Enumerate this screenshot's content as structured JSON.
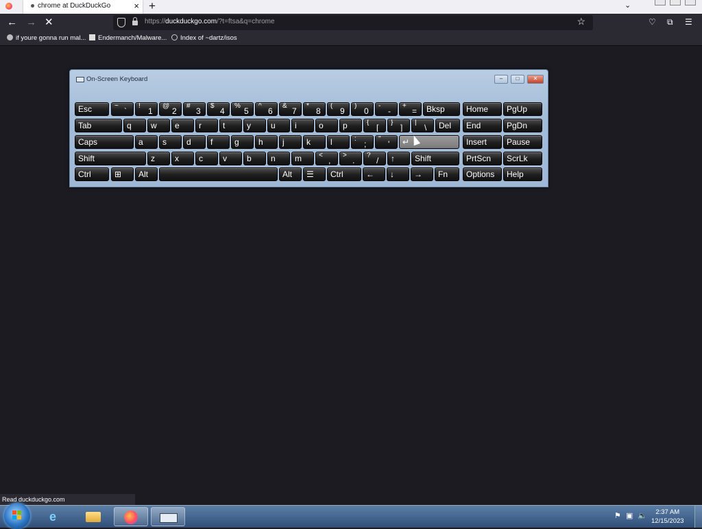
{
  "browser": {
    "active_tab_title": "chrome at DuckDuckGo",
    "url_host": "duckduckgo.com",
    "url_prefix": "https://",
    "url_suffix": "/?t=ftsa&q=chrome",
    "bookmarks": [
      "if youre gonna run mal...",
      "Endermanch/Malware...",
      "Index of ~dartz/isos"
    ],
    "status_text": "Read duckduckgo.com"
  },
  "osk": {
    "title": "On-Screen Keyboard",
    "rows": [
      [
        {
          "label": "Esc"
        },
        {
          "shift": "~",
          "main": "`"
        },
        {
          "shift": "!",
          "main": "1"
        },
        {
          "shift": "@",
          "main": "2"
        },
        {
          "shift": "#",
          "main": "3"
        },
        {
          "shift": "$",
          "main": "4"
        },
        {
          "shift": "%",
          "main": "5"
        },
        {
          "shift": "^",
          "main": "6"
        },
        {
          "shift": "&",
          "main": "7"
        },
        {
          "shift": "*",
          "main": "8"
        },
        {
          "shift": "(",
          "main": "9"
        },
        {
          "shift": ")",
          "main": "0"
        },
        {
          "shift": "-",
          "main": "-"
        },
        {
          "shift": "+",
          "main": "="
        },
        {
          "label": "Bksp"
        },
        {
          "label": "Home"
        },
        {
          "label": "PgUp"
        }
      ],
      [
        {
          "label": "Tab"
        },
        {
          "label": "q"
        },
        {
          "label": "w"
        },
        {
          "label": "e"
        },
        {
          "label": "r"
        },
        {
          "label": "t"
        },
        {
          "label": "y"
        },
        {
          "label": "u"
        },
        {
          "label": "i"
        },
        {
          "label": "o"
        },
        {
          "label": "p"
        },
        {
          "shift": "{",
          "main": "["
        },
        {
          "shift": "}",
          "main": "]"
        },
        {
          "shift": "|",
          "main": "\\"
        },
        {
          "label": "Del"
        },
        {
          "label": "End"
        },
        {
          "label": "PgDn"
        }
      ],
      [
        {
          "label": "Caps"
        },
        {
          "label": "a"
        },
        {
          "label": "s"
        },
        {
          "label": "d"
        },
        {
          "label": "f"
        },
        {
          "label": "g"
        },
        {
          "label": "h"
        },
        {
          "label": "j"
        },
        {
          "label": "k"
        },
        {
          "label": "l"
        },
        {
          "shift": ":",
          "main": ";"
        },
        {
          "shift": "\"",
          "main": "'"
        },
        {
          "label": "↵"
        },
        {
          "label": "Insert"
        },
        {
          "label": "Pause"
        }
      ],
      [
        {
          "label": "Shift"
        },
        {
          "label": "z"
        },
        {
          "label": "x"
        },
        {
          "label": "c"
        },
        {
          "label": "v"
        },
        {
          "label": "b"
        },
        {
          "label": "n"
        },
        {
          "label": "m"
        },
        {
          "shift": "<",
          "main": ","
        },
        {
          "shift": ">",
          "main": "."
        },
        {
          "shift": "?",
          "main": "/"
        },
        {
          "label": "↑"
        },
        {
          "label": "Shift"
        },
        {
          "label": "PrtScn"
        },
        {
          "label": "ScrLk"
        }
      ],
      [
        {
          "label": "Ctrl"
        },
        {
          "label": "⊞"
        },
        {
          "label": "Alt"
        },
        {
          "label": ""
        },
        {
          "label": "Alt"
        },
        {
          "label": "☰"
        },
        {
          "label": "Ctrl"
        },
        {
          "label": "←"
        },
        {
          "label": "↓"
        },
        {
          "label": "→"
        },
        {
          "label": "Fn"
        },
        {
          "label": "Options"
        },
        {
          "label": "Help"
        }
      ]
    ],
    "highlighted_key": "↵"
  },
  "taskbar": {
    "time": "2:37 AM",
    "date": "12/15/2023",
    "items": [
      "internet-explorer",
      "file-explorer",
      "firefox",
      "on-screen-keyboard"
    ],
    "active_item": "firefox"
  },
  "colors": {
    "page_bg": "#1c1b22",
    "toolbar_bg": "#2b2a33",
    "accent": "#2a74c4"
  }
}
